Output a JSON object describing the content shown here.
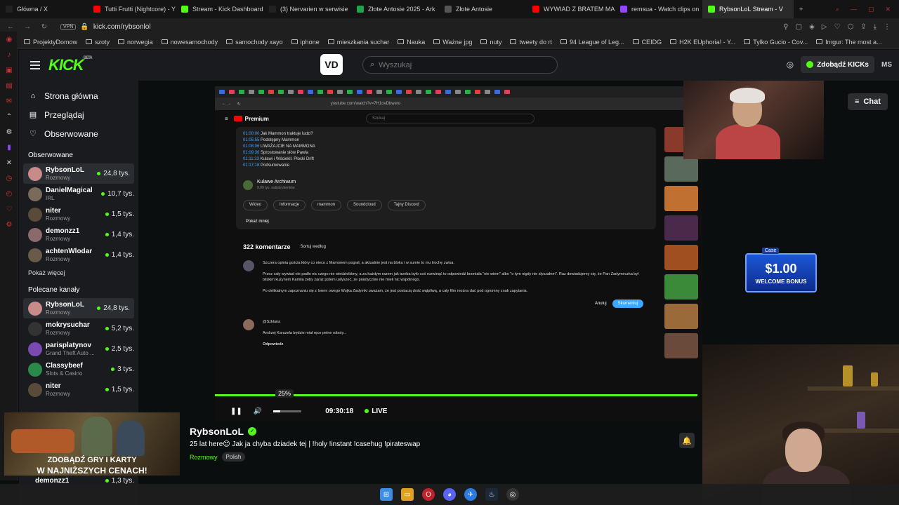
{
  "browser": {
    "tabs": [
      {
        "label": "Główna / X",
        "color": "#222222"
      },
      {
        "label": "Tutti Frutti (Nightcore) - Y",
        "color": "#ff0000"
      },
      {
        "label": "Stream - Kick Dashboard",
        "color": "#53fc18"
      },
      {
        "label": "(3) Nervarien w serwisie",
        "color": "#222222"
      },
      {
        "label": "Złote Antosie 2025 - Ark",
        "color": "#22a34a"
      },
      {
        "label": "Złote Antosie",
        "color": "#555555"
      },
      {
        "label": "WYWIAD Z BRATEM MA",
        "color": "#ff0000"
      },
      {
        "label": "remsua - Watch clips on",
        "color": "#9146ff"
      },
      {
        "label": "RybsonLoL Stream - V",
        "color": "#53fc18"
      }
    ],
    "vpn": "VPN",
    "url": "kick.com/rybsonlol",
    "bookmarks": [
      "ProjektyDomow",
      "szoty",
      "norwegia",
      "nowesamochody",
      "samochody xayo",
      "iphone",
      "mieszkania suchar",
      "Nauka",
      "Ważne jpg",
      "nuty",
      "tweety do rt",
      "94 League of Leg...",
      "CEIDG",
      "H2K EUphoria! - Y...",
      "Tylko Gucio - Cov...",
      "Imgur: The most a..."
    ]
  },
  "header": {
    "logo": "KICK",
    "logo_beta": "BETA",
    "vd_logo": "VD",
    "search_placeholder": "Wyszukaj",
    "get_kicks": "Zdobądź KICKs",
    "user_initials": "MS"
  },
  "sidebar": {
    "nav": [
      {
        "label": "Strona główna",
        "icon": "home-icon"
      },
      {
        "label": "Przeglądaj",
        "icon": "browse-icon"
      },
      {
        "label": "Obserwowane",
        "icon": "heart-icon"
      }
    ],
    "followed_title": "Obserwowane",
    "followed": [
      {
        "name": "RybsonLoL",
        "category": "Rozmowy",
        "viewers": "24,8 tys.",
        "color": "#c98a8a"
      },
      {
        "name": "DanielMagical",
        "category": "IRL",
        "viewers": "10,7 tys.",
        "color": "#7a6a5a"
      },
      {
        "name": "niter",
        "category": "Rozmowy",
        "viewers": "1,5 tys.",
        "color": "#5a4a3a"
      },
      {
        "name": "demonzz1",
        "category": "Rozmowy",
        "viewers": "1,4 tys.",
        "color": "#8a6a6a"
      },
      {
        "name": "achtenWlodar",
        "category": "Rozmowy",
        "viewers": "1,4 tys.",
        "color": "#6a5a4a"
      }
    ],
    "show_more": "Pokaż więcej",
    "recommended_title": "Polecane kanały",
    "recommended": [
      {
        "name": "RybsonLoL",
        "category": "Rozmowy",
        "viewers": "24,8 tys.",
        "color": "#c98a8a"
      },
      {
        "name": "mokrysuchar",
        "category": "Rozmowy",
        "viewers": "5,2 tys.",
        "color": "#333333"
      },
      {
        "name": "parisplatynov",
        "category": "Grand Theft Auto ...",
        "viewers": "2,5 tys.",
        "color": "#7a4ab0"
      },
      {
        "name": "Classybeef",
        "category": "Slots & Casino",
        "viewers": "3 tys.",
        "color": "#2a8a4a"
      },
      {
        "name": "niter",
        "category": "Rozmowy",
        "viewers": "1,5 tys.",
        "color": "#5a4a3a"
      }
    ],
    "bottom_channel": {
      "name": "demonzz1",
      "viewers": "1,3 tys."
    }
  },
  "video": {
    "yt_url": "youtube.com/watch?v=7H1ovDbwero",
    "yt_search": "Szukaj",
    "yt_brand": "Premium",
    "chapters": [
      {
        "time": "01:00:00",
        "title": "Jak Mammon traktuje ludzi?"
      },
      {
        "time": "01:05:55",
        "title": "Podstępny Mammon"
      },
      {
        "time": "01:08:06",
        "title": "UWAŻAJCIE NA MAMMONA"
      },
      {
        "time": "01:09:36",
        "title": "Sprostowanie słów Pawła"
      },
      {
        "time": "01:11:33",
        "title": "Kulawi i Wściekli: Płocki Drift"
      },
      {
        "time": "01:17:18",
        "title": "Podsumowanie"
      }
    ],
    "channel_name": "Kulawe Archiwum",
    "channel_subs": "9,09 tys. subskrybentów",
    "pills": [
      "Wideo",
      "Informacje",
      "mammon",
      "Soundcloud",
      "Tajny Discord"
    ],
    "show_less": "Pokaż mniej",
    "comments_count": "322 komentarze",
    "sort_label": "Sortuj według",
    "comment_paragraphs": [
      "Szczera opinia gościa który co nieco z Mamonem pograł, a aktualnie jest na bloku i w sumie to mu trochę zwisa.",
      "Przez cały wywiad nie padło nic czego nie wiedzieliśmy, a za każdym razem jak trzeba było coś rozwinąć to odpowiedź brzmiała \"nie wiem\" albo \"o tym nigdy nie słyszałem\". Raz dowiadujemy się, że Pan Zadymeczka był bliskim kuzynem Kamila żeby zaraz potem usłyszeć, że praktycznie nie mieli nic wspólnego.",
      "Po delikatnym zapoznaniu się z lorem owego Wujka Zadymki uważam, że jest postacią dość wątpliwą, a cały film można dać pod ogromny znak zapytania."
    ],
    "cancel": "Anuluj",
    "submit": "Skomentuj",
    "reply_author": "@Szklana",
    "reply_text": "Andrzej Karuzela będzie miał ręce pełne roboty...",
    "reply_action": "Odpowiedz",
    "progress_pct": 99,
    "volume_pct": 25,
    "volume_tip": "25%",
    "time": "09:30:18",
    "live": "LIVE",
    "chat_btn": "Chat",
    "casino_brand": "Case",
    "casino_amount": "$1.00",
    "casino_text": "WELCOME BONUS"
  },
  "stream": {
    "streamer": "RybsonLoL",
    "title": "25 lat here😊 Jak ja chyba dziadek tej | !holy !instant !casehug !pirateswap",
    "category": "Rozmowy",
    "language": "Polish"
  },
  "ad": {
    "line1": "ZDOBĄDŹ GRY I KARTY",
    "line2": "W NAJNIŻSZYCH CENACH!"
  },
  "colors": {
    "accent": "#53fc18",
    "bg": "#0b0e0f",
    "sidebar": "#191b1f"
  }
}
